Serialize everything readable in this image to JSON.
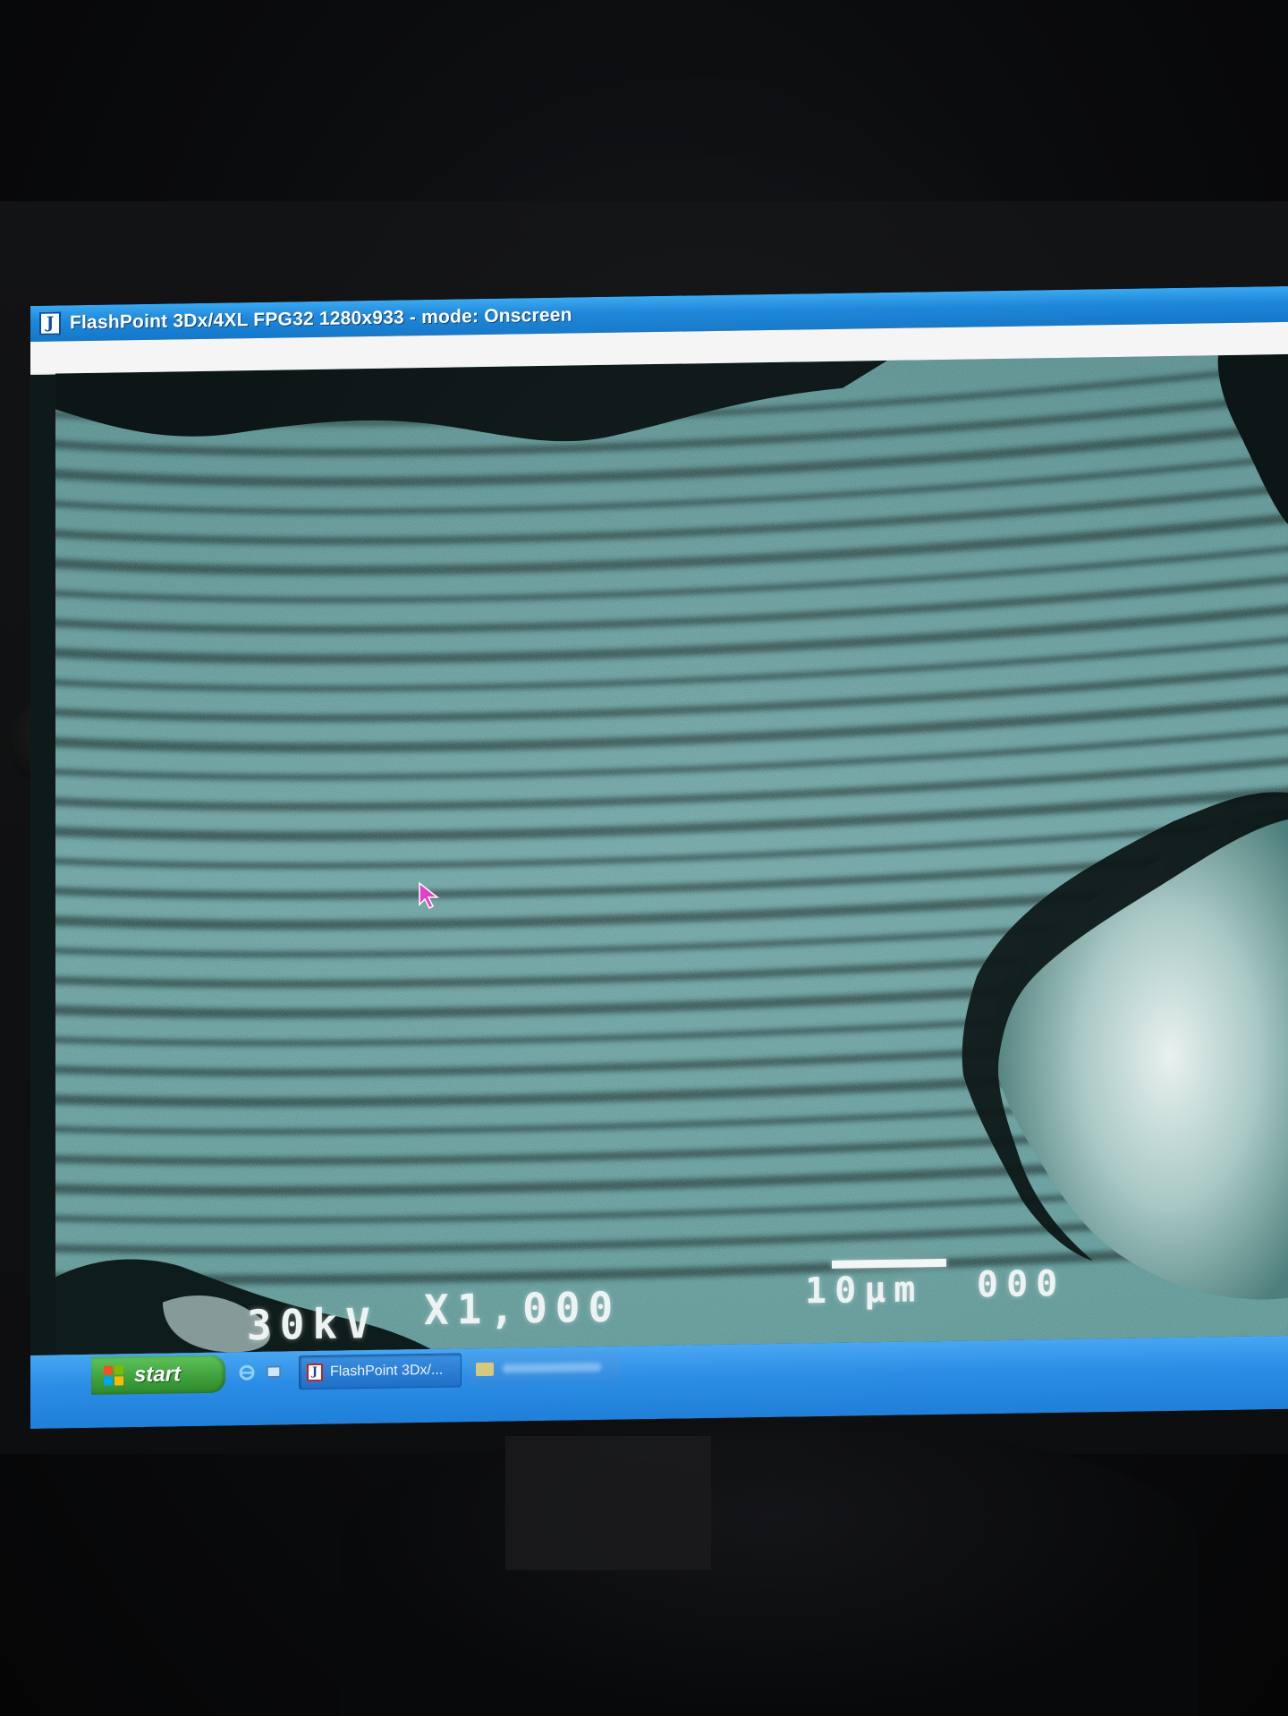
{
  "window": {
    "title": "FlashPoint 3Dx/4XL FPG32 1280x933 - mode: Onscreen",
    "icon": "flashpoint-app-icon"
  },
  "sem_overlay": {
    "accelerating_voltage": "30kV",
    "magnification": "X1,000",
    "scale_bar_label": "10µm",
    "image_id": "000"
  },
  "taskbar": {
    "start_label": "start",
    "quick_launch": [
      "internet-explorer-icon",
      "show-desktop-icon"
    ],
    "tasks": [
      {
        "label": "FlashPoint 3Dx/...",
        "icon": "flashpoint-app-icon",
        "active": true
      },
      {
        "label": "",
        "icon": "folder-icon",
        "active": false
      }
    ]
  },
  "colors": {
    "titlebar": "#1d86d8",
    "taskbar": "#2c8ee6",
    "start_button": "#3d9f3a",
    "sem_tint": "#5f9796",
    "cursor": "#e040c8"
  }
}
